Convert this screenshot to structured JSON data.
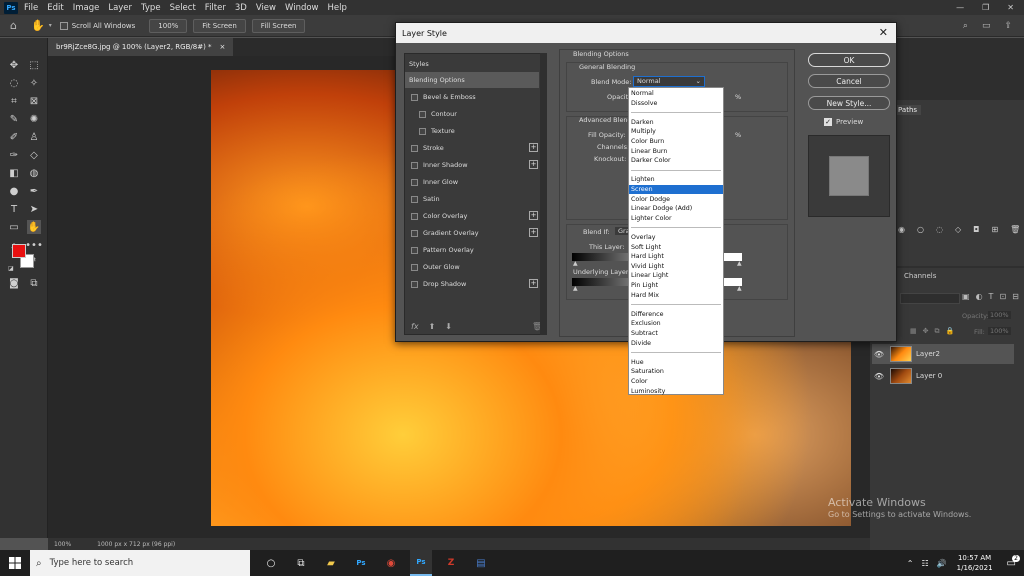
{
  "menubar": {
    "items": [
      "File",
      "Edit",
      "Image",
      "Layer",
      "Type",
      "Select",
      "Filter",
      "3D",
      "View",
      "Window",
      "Help"
    ],
    "logo": "Ps",
    "winctl": [
      "—",
      "❐",
      "✕"
    ]
  },
  "options": {
    "scroll_all_windows": "Scroll All Windows",
    "zoom": "100%",
    "fit_screen": "Fit Screen",
    "fill_screen": "Fill Screen"
  },
  "document_tab": {
    "title": "br9RjZce8G.jpg @ 100% (Layer2, RGB/8#) *",
    "close": "×"
  },
  "status": {
    "zoom": "100%",
    "info": "1000 px x 712 px (96 ppi)"
  },
  "dialog": {
    "title": "Layer Style",
    "close": "✕",
    "styles_header": "Styles",
    "styles": [
      {
        "label": "Blending Options",
        "checkbox": false,
        "plus": false,
        "indent": false,
        "active": true
      },
      {
        "label": "Bevel & Emboss",
        "checkbox": true,
        "plus": false,
        "indent": false
      },
      {
        "label": "Contour",
        "checkbox": true,
        "plus": false,
        "indent": true
      },
      {
        "label": "Texture",
        "checkbox": true,
        "plus": false,
        "indent": true
      },
      {
        "label": "Stroke",
        "checkbox": true,
        "plus": true,
        "indent": false
      },
      {
        "label": "Inner Shadow",
        "checkbox": true,
        "plus": true,
        "indent": false
      },
      {
        "label": "Inner Glow",
        "checkbox": true,
        "plus": false,
        "indent": false
      },
      {
        "label": "Satin",
        "checkbox": true,
        "plus": false,
        "indent": false
      },
      {
        "label": "Color Overlay",
        "checkbox": true,
        "plus": true,
        "indent": false
      },
      {
        "label": "Gradient Overlay",
        "checkbox": true,
        "plus": true,
        "indent": false
      },
      {
        "label": "Pattern Overlay",
        "checkbox": true,
        "plus": false,
        "indent": false
      },
      {
        "label": "Outer Glow",
        "checkbox": true,
        "plus": false,
        "indent": false
      },
      {
        "label": "Drop Shadow",
        "checkbox": true,
        "plus": true,
        "indent": false
      }
    ],
    "fx": "fx",
    "blending_options": "Blending Options",
    "general_blending": "General Blending",
    "blend_mode_label": "Blend Mode:",
    "blend_mode_value": "Normal",
    "opacity_label": "Opacity:",
    "opacity_pct": "%",
    "advanced_blending": "Advanced Blendi",
    "fill_opacity_label": "Fill Opacity:",
    "fill_pct": "%",
    "channels_label": "Channels:",
    "knockout_label": "Knockout:",
    "blend_if_label": "Blend If:",
    "blend_if_value": "Gra",
    "this_layer_label": "This Layer:",
    "underlying_layer_label": "Underlying Layer:",
    "ok": "OK",
    "cancel": "Cancel",
    "new_style": "New Style...",
    "preview": "Preview"
  },
  "blend_modes": {
    "groups": [
      [
        "Normal",
        "Dissolve"
      ],
      [
        "Darken",
        "Multiply",
        "Color Burn",
        "Linear Burn",
        "Darker Color"
      ],
      [
        "Lighten",
        "Screen",
        "Color Dodge",
        "Linear Dodge (Add)",
        "Lighter Color"
      ],
      [
        "Overlay",
        "Soft Light",
        "Hard Light",
        "Vivid Light",
        "Linear Light",
        "Pin Light",
        "Hard Mix"
      ],
      [
        "Difference",
        "Exclusion",
        "Subtract",
        "Divide"
      ],
      [
        "Hue",
        "Saturation",
        "Color",
        "Luminosity"
      ]
    ],
    "highlighted": "Screen"
  },
  "right_panel": {
    "paths_tab": "Paths",
    "channels_tab": "Channels",
    "opacity_label": "Opacity:",
    "opacity_value": "100%",
    "fill_label": "Fill:",
    "fill_value": "100%",
    "layers": [
      {
        "name": "Layer2",
        "selected": true
      },
      {
        "name": "Layer 0",
        "selected": false
      }
    ]
  },
  "taskbar": {
    "search_placeholder": "Type here to search",
    "time": "10:57 AM",
    "date": "1/16/2021",
    "notification_count": "2",
    "apps": [
      "task-view",
      "file-explorer",
      "photoshop-pinned",
      "chrome",
      "photoshop-active",
      "filezilla",
      "word"
    ]
  },
  "watermark": {
    "title": "Activate Windows",
    "subtitle": "Go to Settings to activate Windows."
  },
  "colors": {
    "foreground": "#e81010",
    "background": "#ffffff",
    "highlight": "#1e6fd0"
  }
}
